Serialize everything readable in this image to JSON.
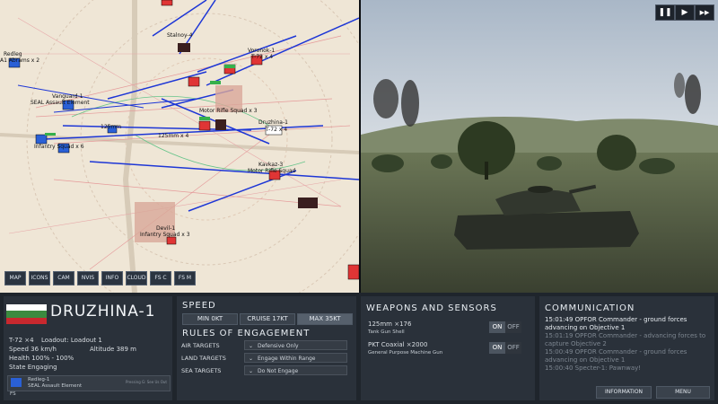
{
  "map": {
    "buttons": [
      "MAP",
      "ICONS",
      "CAM",
      "NVIS",
      "INFO",
      "CLOUD",
      "FS C",
      "FS M"
    ],
    "labels": {
      "stalnoy": "Stalnoy-4",
      "voronok": "Voronok-1",
      "voronok_sub": "T-72 x 4",
      "redleg": "Redleg",
      "redleg_sub": "A1 Abrams x 2",
      "vanguard": "Vanguard-1",
      "vanguard_sub": "SEAL Assault Element",
      "infantry_left": "Infantry Squad x 6",
      "motor": "Motor Rifle Squad x 3",
      "tanks_sub": "T-72 x 4",
      "druzhina": "Druzhina-1",
      "druzhina_sub": "T-72 x 4",
      "kavkaz": "Kavkaz-3",
      "kavkaz_sub": "Motor Rifle Squad",
      "mm125_a": "125mm",
      "mm125_b": "125mm x 4",
      "devil": "Devil-1",
      "devil_sub": "Infantry Squad x 3"
    }
  },
  "controls": {
    "pause": "❚❚",
    "play": "▶",
    "ff": "▶▶"
  },
  "unit": {
    "name": "DRUZHINA-1",
    "type": "T-72 ×4",
    "loadout": "Loadout: Loadout 1",
    "speed": "Speed 36 km/h",
    "altitude": "Altitude 389 m",
    "health": "Health 100% - 100%",
    "state": "State Engaging",
    "target_name": "Redleg-1",
    "target_desc": "SEAL Assault Element",
    "target_hint": "Pressing G: See Us Out",
    "fs": "FS"
  },
  "speed": {
    "title": "SPEED",
    "options": [
      "MIN 0KT",
      "CRUISE 17KT",
      "MAX 35KT"
    ],
    "selected": 2
  },
  "roe": {
    "title": "RULES OF ENGAGEMENT",
    "rows": [
      {
        "label": "AIR TARGETS",
        "value": "Defensive Only"
      },
      {
        "label": "LAND TARGETS",
        "value": "Engage Within Range"
      },
      {
        "label": "SEA TARGETS",
        "value": "Do Not Engage"
      }
    ]
  },
  "weapons": {
    "title": "WEAPONS AND SENSORS",
    "items": [
      {
        "name": "125mm ×176",
        "desc": "Tank Gun Shell",
        "on": "ON",
        "off": "OFF"
      },
      {
        "name": "PKT Coaxial ×2000",
        "desc": "General Purpose Machine Gun",
        "on": "ON",
        "off": "OFF"
      }
    ]
  },
  "comm": {
    "title": "COMMUNICATION",
    "messages": [
      {
        "text": "15:01:49 OPFOR Commander - ground forces advancing on Objective 1"
      },
      {
        "text": "15:01:19 OPFOR Commander - advancing forces to capture Objective 2"
      },
      {
        "text": "15:00:49 OPFOR Commander - ground forces advancing on Objective 1"
      },
      {
        "text": "15:00:40 Specter-1: Pawnway!"
      }
    ],
    "info_btn": "INFORMATION",
    "menu_btn": "MENU"
  },
  "colors": {
    "flag_white": "#ffffff",
    "flag_green": "#3b8a3f",
    "flag_red": "#c8282e"
  }
}
